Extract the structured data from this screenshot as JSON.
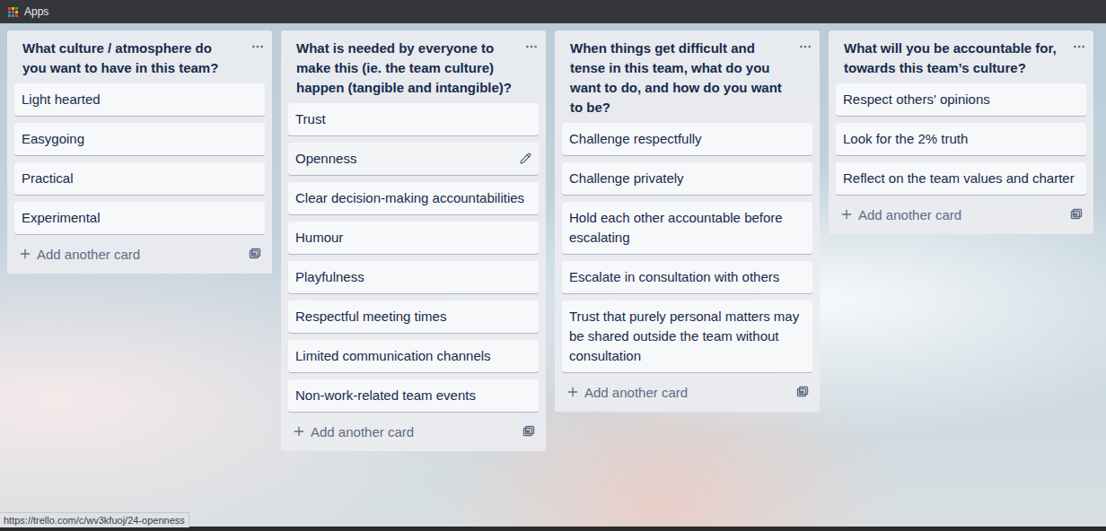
{
  "top_bar": {
    "label": "Apps"
  },
  "lists": [
    {
      "title": "What culture / atmosphere do you want to have in this team?",
      "add_label": "Add another card",
      "cards": [
        {
          "text": "Light hearted",
          "hovered": false
        },
        {
          "text": "Easygoing",
          "hovered": false
        },
        {
          "text": "Practical",
          "hovered": false
        },
        {
          "text": "Experimental",
          "hovered": false
        }
      ]
    },
    {
      "title": "What is needed by everyone to make this (ie. the team culture) happen (tangible and intangible)?",
      "add_label": "Add another card",
      "cards": [
        {
          "text": "Trust",
          "hovered": false
        },
        {
          "text": "Openness",
          "hovered": true
        },
        {
          "text": "Clear decision-making accountabilities",
          "hovered": false
        },
        {
          "text": "Humour",
          "hovered": false
        },
        {
          "text": "Playfulness",
          "hovered": false
        },
        {
          "text": "Respectful meeting times",
          "hovered": false
        },
        {
          "text": "Limited communication channels",
          "hovered": false
        },
        {
          "text": "Non-work-related team events",
          "hovered": false
        }
      ]
    },
    {
      "title": "When things get difficult and tense in this team, what do you want to do, and how do you want to be?",
      "add_label": "Add another card",
      "cards": [
        {
          "text": "Challenge respectfully",
          "hovered": false
        },
        {
          "text": "Challenge privately",
          "hovered": false
        },
        {
          "text": "Hold each other accountable before escalating",
          "hovered": false
        },
        {
          "text": "Escalate in consultation with others",
          "hovered": false
        },
        {
          "text": "Trust that purely personal matters may be shared outside the team without consultation",
          "hovered": false
        }
      ]
    },
    {
      "title": "What will you be accountable for, towards this team’s culture?",
      "add_label": "Add another card",
      "cards": [
        {
          "text": "Respect others' opinions",
          "hovered": false
        },
        {
          "text": "Look for the 2% truth",
          "hovered": false
        },
        {
          "text": "Reflect on the team values and charter",
          "hovered": false
        }
      ]
    }
  ],
  "status_url": "https://trello.com/c/wv3kfuoj/24-openness"
}
